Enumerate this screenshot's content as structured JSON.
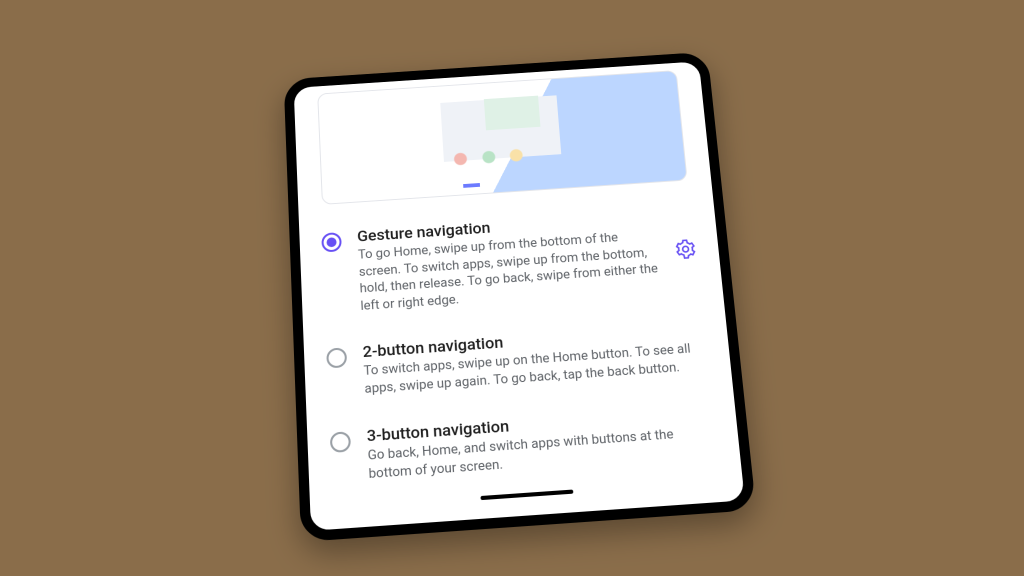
{
  "accent": "#6750f4",
  "options": [
    {
      "title": "Gesture navigation",
      "desc": "To go Home, swipe up from the bottom of the screen. To switch apps, swipe up from the bottom, hold, then release. To go back, swipe from either the left or right edge.",
      "selected": true,
      "has_settings": true
    },
    {
      "title": "2-button navigation",
      "desc": "To switch apps, swipe up on the Home button. To see all apps, swipe up again. To go back, tap the back button.",
      "selected": false,
      "has_settings": false
    },
    {
      "title": "3-button navigation",
      "desc": "Go back, Home, and switch apps with buttons at the bottom of your screen.",
      "selected": false,
      "has_settings": false
    }
  ]
}
